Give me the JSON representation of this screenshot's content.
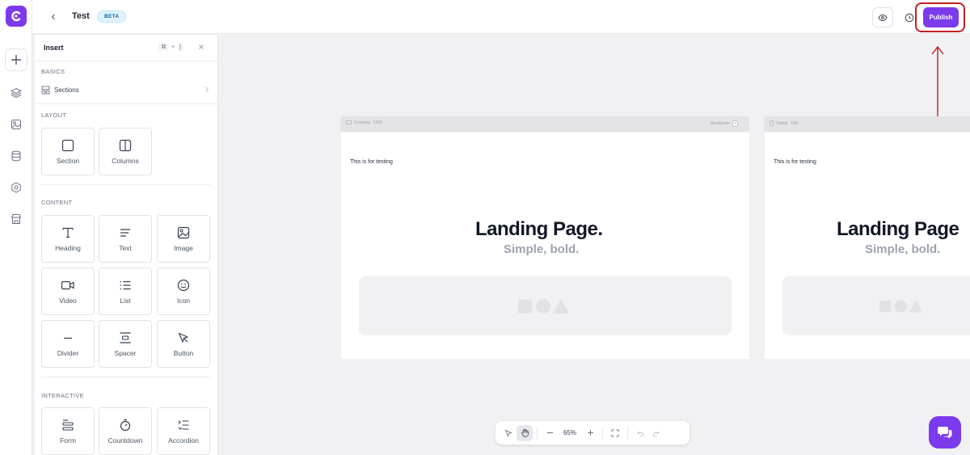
{
  "topbar": {
    "title": "Test",
    "badge": "BETA",
    "publish_label": "Publish"
  },
  "insert_panel": {
    "title": "Insert",
    "shortcut_key": "⌘",
    "shortcut_plus": "+",
    "shortcut_char": "[",
    "basics": {
      "label": "BASICS",
      "sections_label": "Sections"
    },
    "layout": {
      "label": "LAYOUT",
      "items": [
        "Section",
        "Columns"
      ]
    },
    "content": {
      "label": "CONTENT",
      "items": [
        "Heading",
        "Text",
        "Image",
        "Video",
        "List",
        "Icon",
        "Divider",
        "Spacer",
        "Button"
      ]
    },
    "interactive": {
      "label": "INTERACTIVE",
      "items": [
        "Form",
        "Countdown",
        "Accordion"
      ]
    }
  },
  "canvas": {
    "desktop": {
      "name": "Desktop",
      "width": "1100",
      "breakpoint_label": "Breakpoint",
      "testing_text": "This is for testing",
      "heading": "Landing Page.",
      "subheading": "Simple, bold."
    },
    "tablet": {
      "name": "Tablet",
      "width": "768",
      "testing_text": "This is for testing",
      "heading": "Landing Page",
      "subheading": "Simple, bold."
    }
  },
  "zoom": {
    "value": "65%"
  },
  "colors": {
    "accent": "#7c3aed",
    "highlight": "#c0201e"
  }
}
